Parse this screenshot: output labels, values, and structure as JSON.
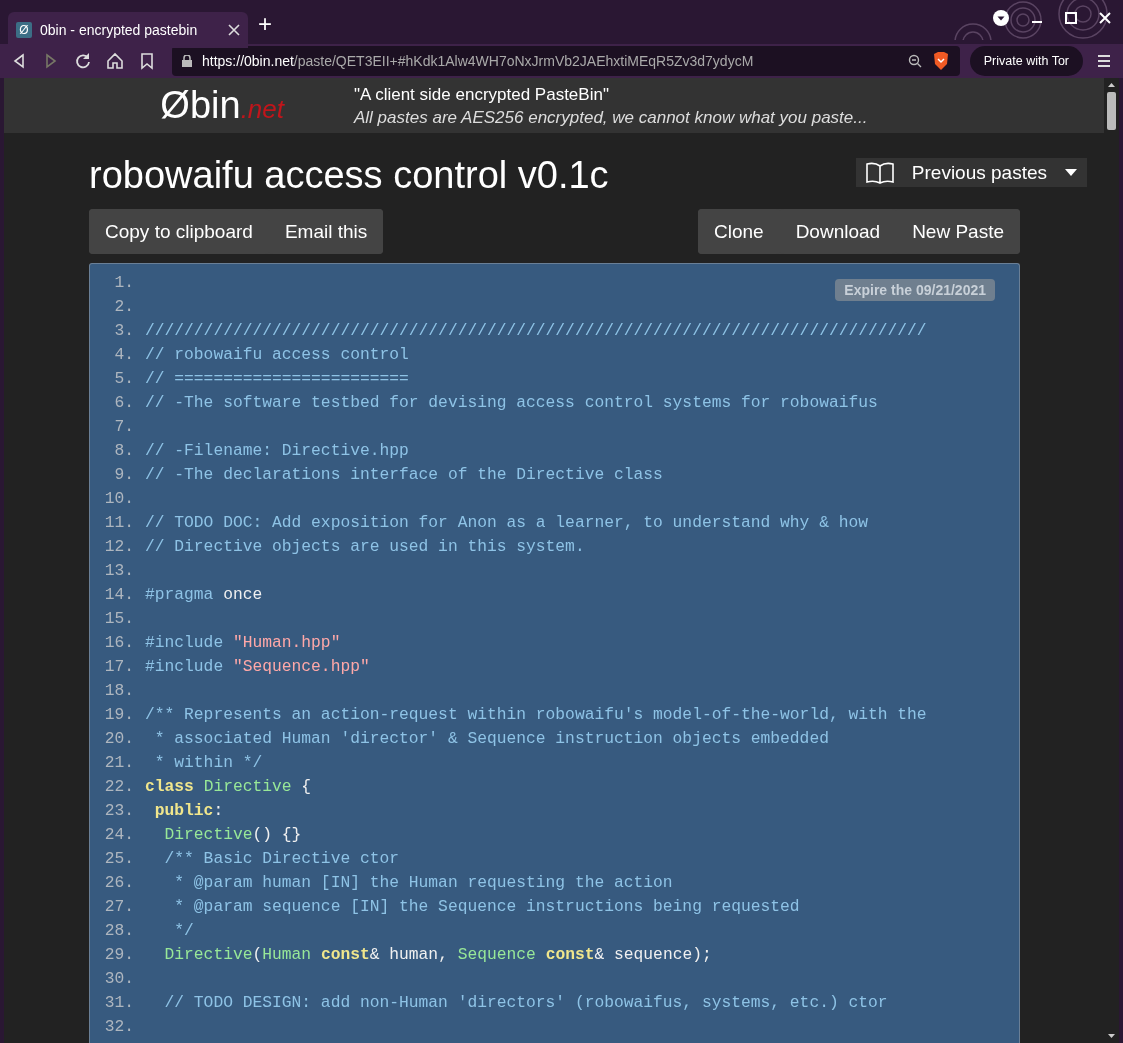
{
  "browser": {
    "tab": {
      "favicon": "Ø",
      "title": "0bin - encrypted pastebin",
      "selected": true
    },
    "new_tab": "+",
    "url": {
      "host": "https://0bin.net",
      "path": "/paste/QET3EII+#hKdk1Alw4WH7oNxJrmVb2JAEhxtiMEqR5Zv3d7ydycM"
    },
    "tor_button": "Private with Tor"
  },
  "header": {
    "logo": "Øbin",
    "logo_suffix": ".net",
    "tagline": "\"A client side encrypted PasteBin\"",
    "subtitle": "All pastes are AES256 encrypted, we cannot know what you paste..."
  },
  "paste": {
    "title": "robowaifu access control v0.1c",
    "previous_pastes": "Previous pastes",
    "left_buttons": [
      "Copy to clipboard",
      "Email this"
    ],
    "right_buttons": [
      "Clone",
      "Download",
      "New Paste"
    ],
    "expire": "Expire the 09/21/2021",
    "lines": [
      {
        "n": "1."
      },
      {
        "n": "2."
      },
      {
        "n": "3.",
        "tokens": [
          {
            "kind": "comment",
            "text": "////////////////////////////////////////////////////////////////////////////////"
          }
        ]
      },
      {
        "n": "4.",
        "tokens": [
          {
            "kind": "comment",
            "text": "// robowaifu access control"
          }
        ]
      },
      {
        "n": "5.",
        "tokens": [
          {
            "kind": "comment",
            "text": "// ========================"
          }
        ]
      },
      {
        "n": "6.",
        "tokens": [
          {
            "kind": "comment",
            "text": "// -The software testbed for devising access control systems for robowaifus"
          }
        ]
      },
      {
        "n": "7."
      },
      {
        "n": "8.",
        "tokens": [
          {
            "kind": "comment",
            "text": "// -Filename: Directive.hpp"
          }
        ]
      },
      {
        "n": "9.",
        "tokens": [
          {
            "kind": "comment",
            "text": "// -The declarations interface of the Directive class"
          }
        ]
      },
      {
        "n": "10."
      },
      {
        "n": "11.",
        "tokens": [
          {
            "kind": "comment",
            "text": "// TODO DOC: Add exposition for Anon as a learner, to understand why & how"
          }
        ]
      },
      {
        "n": "12.",
        "tokens": [
          {
            "kind": "comment",
            "text": "// Directive objects are used in this system."
          }
        ]
      },
      {
        "n": "13."
      },
      {
        "n": "14.",
        "tokens": [
          {
            "kind": "directive",
            "text": "#pragma"
          },
          {
            "kind": "plain",
            "text": " once"
          }
        ]
      },
      {
        "n": "15."
      },
      {
        "n": "16.",
        "tokens": [
          {
            "kind": "directive",
            "text": "#include "
          },
          {
            "kind": "string",
            "text": "\"Human.hpp\""
          }
        ]
      },
      {
        "n": "17.",
        "tokens": [
          {
            "kind": "directive",
            "text": "#include "
          },
          {
            "kind": "string",
            "text": "\"Sequence.hpp\""
          }
        ]
      },
      {
        "n": "18."
      },
      {
        "n": "19.",
        "tokens": [
          {
            "kind": "comment",
            "text": "/** Represents an action-request within robowaifu's model-of-the-world, with the"
          }
        ]
      },
      {
        "n": "20.",
        "tokens": [
          {
            "kind": "comment",
            "text": " * associated Human 'director' & Sequence instruction objects embedded"
          }
        ]
      },
      {
        "n": "21.",
        "tokens": [
          {
            "kind": "comment",
            "text": " * within */"
          }
        ]
      },
      {
        "n": "22.",
        "tokens": [
          {
            "kind": "keyword",
            "text": "class"
          },
          {
            "kind": "type",
            "text": " Directive"
          },
          {
            "kind": "plain",
            "text": " {"
          }
        ]
      },
      {
        "n": "23.",
        "tokens": [
          {
            "kind": "keyword",
            "text": " public"
          },
          {
            "kind": "plain",
            "text": ":"
          }
        ]
      },
      {
        "n": "24.",
        "tokens": [
          {
            "kind": "type",
            "text": "  Directive"
          },
          {
            "kind": "plain",
            "text": "() {}"
          }
        ]
      },
      {
        "n": "25.",
        "tokens": [
          {
            "kind": "comment",
            "text": "  /** Basic Directive ctor"
          }
        ]
      },
      {
        "n": "26.",
        "tokens": [
          {
            "kind": "comment",
            "text": "   * @param human [IN] the Human requesting the action"
          }
        ]
      },
      {
        "n": "27.",
        "tokens": [
          {
            "kind": "comment",
            "text": "   * @param sequence [IN] the Sequence instructions being requested"
          }
        ]
      },
      {
        "n": "28.",
        "tokens": [
          {
            "kind": "comment",
            "text": "   */"
          }
        ]
      },
      {
        "n": "29.",
        "tokens": [
          {
            "kind": "type",
            "text": "  Directive"
          },
          {
            "kind": "plain",
            "text": "("
          },
          {
            "kind": "type",
            "text": "Human"
          },
          {
            "kind": "keyword",
            "text": " const"
          },
          {
            "kind": "plain",
            "text": "& human, "
          },
          {
            "kind": "type",
            "text": "Sequence"
          },
          {
            "kind": "keyword",
            "text": " const"
          },
          {
            "kind": "plain",
            "text": "& sequence);"
          }
        ]
      },
      {
        "n": "30."
      },
      {
        "n": "31.",
        "tokens": [
          {
            "kind": "comment",
            "text": "  // TODO DESIGN: add non-Human 'directors' (robowaifus, systems, etc.) ctor"
          }
        ]
      },
      {
        "n": "32."
      }
    ]
  }
}
